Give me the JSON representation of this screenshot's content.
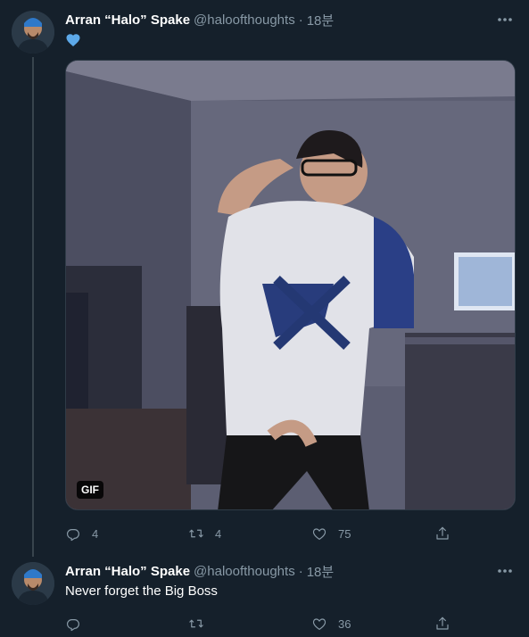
{
  "tweets": [
    {
      "name": "Arran “Halo” Spake",
      "handle": "@haloofthoughts",
      "separator": "·",
      "time": "18분",
      "text": "💙",
      "media_badge": "GIF",
      "reply_count": "4",
      "retweet_count": "4",
      "like_count": "75"
    },
    {
      "name": "Arran “Halo” Spake",
      "handle": "@haloofthoughts",
      "separator": "·",
      "time": "18분",
      "text": "Never forget the Big Boss",
      "reply_count": "",
      "retweet_count": "",
      "like_count": "36"
    }
  ],
  "icons": {
    "more": "more-horizontal-icon",
    "reply": "reply-icon",
    "retweet": "retweet-icon",
    "like": "heart-icon",
    "share": "share-icon"
  },
  "colors": {
    "background": "#15202b",
    "secondary_text": "#8899a6",
    "heart_blue": "#5da9e9"
  }
}
